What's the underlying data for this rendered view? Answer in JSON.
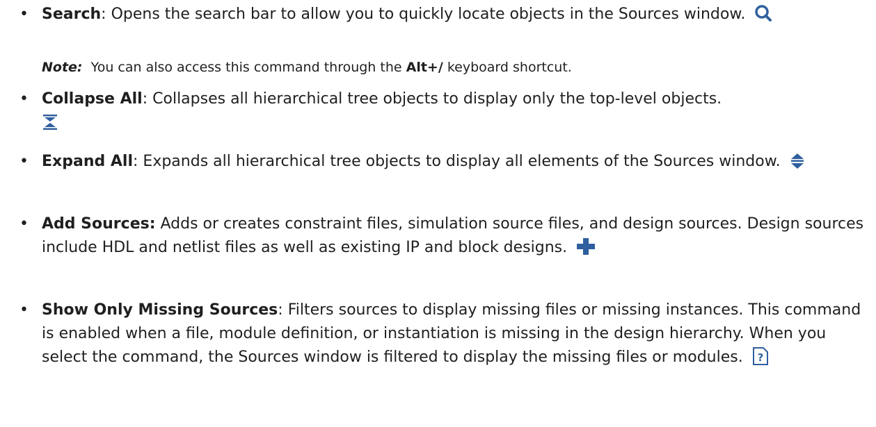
{
  "items": [
    {
      "term": "Search",
      "sep": ":",
      "desc": " Opens the search bar to allow you to quickly locate objects in the Sources window.",
      "icon": "search-icon",
      "note": {
        "label": "Note:",
        "before": "  You can also access this command through the ",
        "shortcut": "Alt+/",
        "after": " keyboard shortcut."
      }
    },
    {
      "term": "Collapse All",
      "sep": ":",
      "desc": " Collapses all hierarchical tree objects to display only the top-level objects.",
      "icon": "collapse-all-icon"
    },
    {
      "term": "Expand All",
      "sep": ":",
      "desc": " Expands all hierarchical tree objects to display all elements of the Sources window.",
      "icon": "expand-all-icon"
    },
    {
      "term": "Add Sources:",
      "sep": "",
      "desc": " Adds or creates constraint files, simulation source files, and design sources. Design sources include HDL and netlist files as well as existing IP and block designs.",
      "icon": "add-icon"
    },
    {
      "term": "Show Only Missing Sources",
      "sep": ":",
      "desc": " Filters sources to display missing files or missing instances. This command is enabled when a file, module definition, or instantiation is missing in the design hierarchy. When you select the command, the Sources window is filtered to display the missing files or modules.",
      "icon": "missing-sources-icon"
    }
  ],
  "bullet": "•",
  "colors": {
    "icon_blue": "#2f5f9e",
    "text": "#1f1f1f"
  }
}
